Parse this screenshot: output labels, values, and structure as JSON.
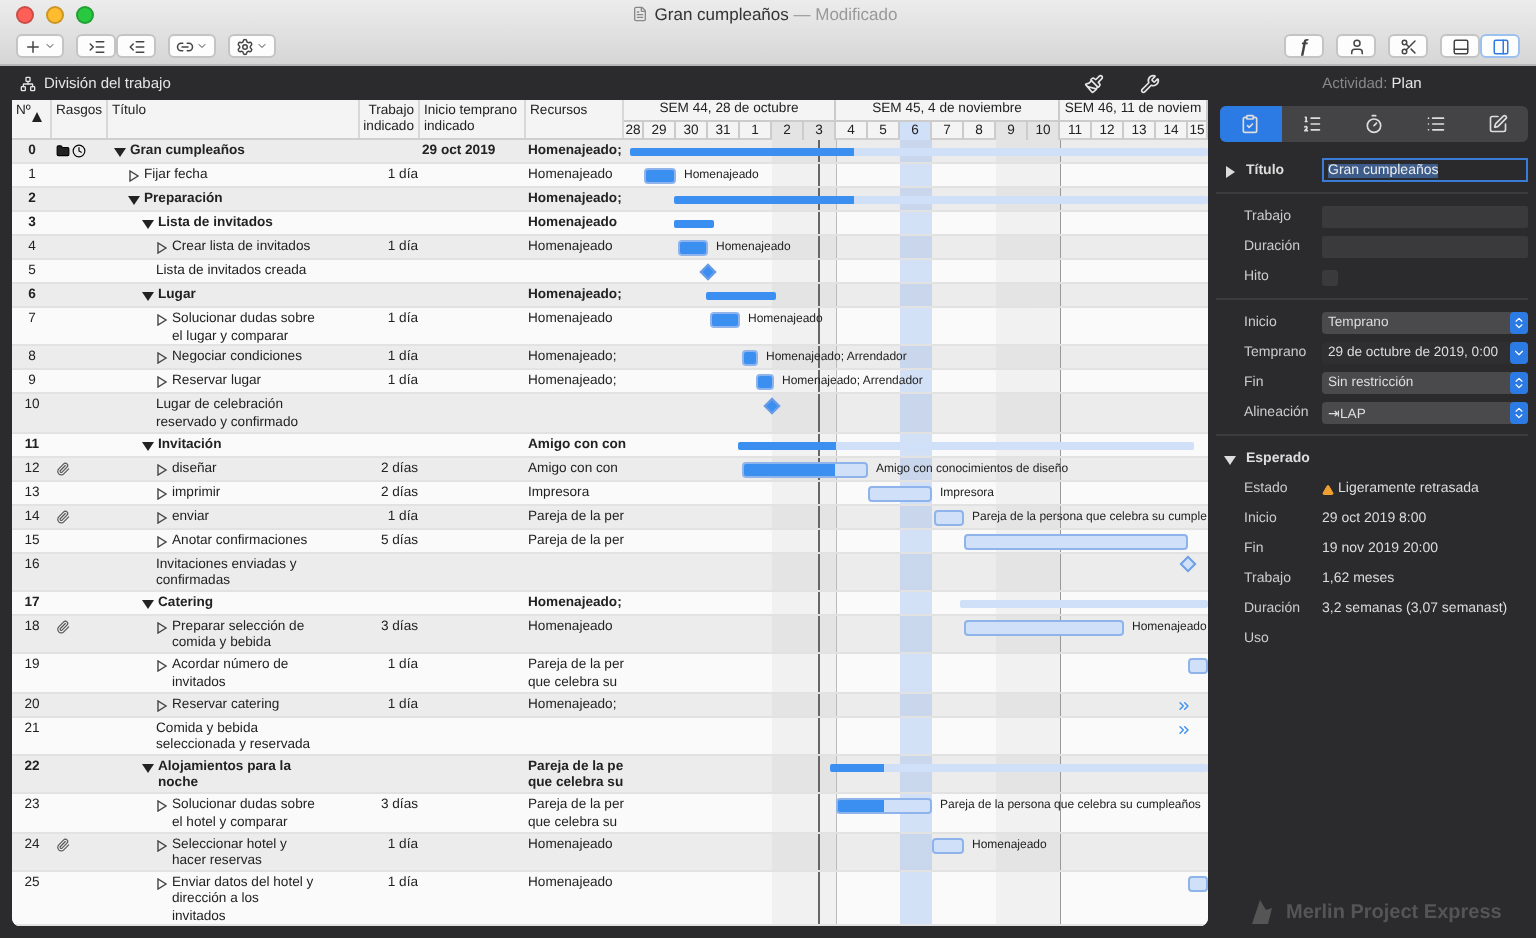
{
  "window": {
    "title": "Gran cumpleaños",
    "status": "— Modificado"
  },
  "toolbar": {
    "function_button": "ƒ",
    "view_toggles": [
      {
        "selected": false
      },
      {
        "selected": true
      }
    ]
  },
  "view_bar": {
    "view": "División del trabajo"
  },
  "table": {
    "columns": [
      {
        "label": "Nº",
        "sorted": true
      },
      {
        "label": "Rasgos"
      },
      {
        "label": "Título"
      },
      {
        "label": "Trabajo indicado"
      },
      {
        "label": "Inicio temprano indicado"
      },
      {
        "label": "Recursos"
      }
    ],
    "rows": [
      {
        "number": "0",
        "kind": "project",
        "expanded": true,
        "title": "Gran cumpleaños",
        "start": "29 oct 2019",
        "resources": "Homenajeado;",
        "children": [
          {
            "number": "1",
            "kind": "task",
            "title": "Fijar fecha",
            "work": "1 día",
            "resources": "Homenajeado",
            "bar_label": "Homenajeado"
          },
          {
            "number": "2",
            "kind": "group",
            "expanded": true,
            "title": "Preparación",
            "resources": "Homenajeado;",
            "children": [
              {
                "number": "3",
                "kind": "group",
                "expanded": true,
                "title": "Lista de invitados",
                "resources": "Homenajeado",
                "children": [
                  {
                    "number": "4",
                    "kind": "task",
                    "title": "Crear lista de invitados",
                    "work": "1 día",
                    "resources": "Homenajeado",
                    "bar_label": "Homenajeado"
                  },
                  {
                    "number": "5",
                    "kind": "milestone",
                    "title": "Lista de invitados creada"
                  }
                ]
              },
              {
                "number": "6",
                "kind": "group",
                "expanded": true,
                "title": "Lugar",
                "resources": "Homenajeado;",
                "children": [
                  {
                    "number": "7",
                    "kind": "task",
                    "title": "Solucionar dudas sobre el lugar y comparar",
                    "work": "1 día",
                    "resources": "Homenajeado",
                    "bar_label": "Homenajeado"
                  },
                  {
                    "number": "8",
                    "kind": "task",
                    "title": "Negociar condiciones",
                    "work": "1 día",
                    "resources": "Homenajeado;",
                    "bar_label": "Homenajeado; Arrendador"
                  },
                  {
                    "number": "9",
                    "kind": "task",
                    "title": "Reservar lugar",
                    "work": "1 día",
                    "resources": "Homenajeado;",
                    "bar_label": "Homenajeado; Arrendador"
                  },
                  {
                    "number": "10",
                    "kind": "milestone",
                    "title": "Lugar de celebración reservado y confirmado"
                  }
                ]
              },
              {
                "number": "11",
                "kind": "group",
                "expanded": true,
                "title": "Invitación",
                "resources": "Amigo con con",
                "children": [
                  {
                    "number": "12",
                    "kind": "task",
                    "attachment": true,
                    "title": "diseñar",
                    "work": "2 días",
                    "resources": "Amigo con con",
                    "bar_label": "Amigo con conocimientos de diseño"
                  },
                  {
                    "number": "13",
                    "kind": "task",
                    "title": "imprimir",
                    "work": "2 días",
                    "resources": "Impresora",
                    "bar_label": "Impresora"
                  },
                  {
                    "number": "14",
                    "kind": "task",
                    "attachment": true,
                    "title": "enviar",
                    "work": "1 día",
                    "resources": "Pareja de la per",
                    "bar_label": "Pareja de la persona que celebra su cumple"
                  },
                  {
                    "number": "15",
                    "kind": "task",
                    "title": "Anotar confirmaciones",
                    "work": "5 días",
                    "resources": "Pareja de la per"
                  },
                  {
                    "number": "16",
                    "kind": "milestone",
                    "title": "Invitaciones enviadas y confirmadas"
                  }
                ]
              },
              {
                "number": "17",
                "kind": "group",
                "expanded": true,
                "title": "Catering",
                "resources": "Homenajeado;",
                "children": [
                  {
                    "number": "18",
                    "kind": "task",
                    "attachment": true,
                    "title": "Preparar selección de comida y bebida",
                    "work": "3 días",
                    "resources": "Homenajeado",
                    "bar_label": "Homenajeado"
                  },
                  {
                    "number": "19",
                    "kind": "task",
                    "title": "Acordar número de invitados",
                    "work": "1 día",
                    "resources": "Pareja de la per\nque celebra su"
                  },
                  {
                    "number": "20",
                    "kind": "task",
                    "title": "Reservar catering",
                    "work": "1 día",
                    "resources": "Homenajeado;"
                  },
                  {
                    "number": "21",
                    "kind": "milestone",
                    "title": "Comida y bebida seleccionada y reservada"
                  }
                ]
              },
              {
                "number": "22",
                "kind": "group",
                "expanded": true,
                "title": "Alojamientos para la noche",
                "resources": "Pareja de la pe\nque celebra su",
                "children": [
                  {
                    "number": "23",
                    "kind": "task",
                    "title": "Solucionar dudas sobre el hotel y comparar",
                    "work": "3 días",
                    "resources": "Pareja de la per\nque celebra su",
                    "bar_label": "Pareja de la persona que celebra su cumpleaños"
                  },
                  {
                    "number": "24",
                    "kind": "task",
                    "attachment": true,
                    "title": "Seleccionar hotel y hacer reservas",
                    "work": "1 día",
                    "resources": "Homenajeado",
                    "bar_label": "Homenajeado"
                  },
                  {
                    "number": "25",
                    "kind": "task",
                    "title": "Enviar datos del hotel y dirección a los invitados",
                    "work": "1 día",
                    "resources": "Homenajeado"
                  }
                ]
              }
            ]
          }
        ]
      }
    ]
  },
  "timeline": {
    "weeks": [
      {
        "label": "SEM 44, 28 de octubre",
        "days": [
          {
            "label": "28",
            "weekend": false,
            "today": false
          },
          {
            "label": "29",
            "weekend": false,
            "today": false
          },
          {
            "label": "30",
            "weekend": false,
            "today": false
          },
          {
            "label": "31",
            "weekend": false,
            "today": false
          },
          {
            "label": "1",
            "weekend": false,
            "today": false
          },
          {
            "label": "2",
            "weekend": true,
            "today": false
          },
          {
            "label": "3",
            "weekend": true,
            "today": false
          }
        ]
      },
      {
        "label": "SEM 45, 4 de noviembre",
        "days": [
          {
            "label": "4",
            "weekend": false,
            "today": false
          },
          {
            "label": "5",
            "weekend": false,
            "today": false
          },
          {
            "label": "6",
            "weekend": false,
            "today": true
          },
          {
            "label": "7",
            "weekend": false,
            "today": false
          },
          {
            "label": "8",
            "weekend": false,
            "today": false
          },
          {
            "label": "9",
            "weekend": true,
            "today": false
          },
          {
            "label": "10",
            "weekend": true,
            "today": false
          }
        ]
      },
      {
        "label": "SEM 46, 11 de noviem",
        "days": [
          {
            "label": "11",
            "weekend": false,
            "today": false
          },
          {
            "label": "12",
            "weekend": false,
            "today": false
          },
          {
            "label": "13",
            "weekend": false,
            "today": false
          },
          {
            "label": "14",
            "weekend": false,
            "today": false
          },
          {
            "label": "15",
            "weekend": false,
            "today": false
          }
        ]
      }
    ]
  },
  "inspector": {
    "activity_label": "Actividad:",
    "activity": "Plan",
    "tabs": [
      {
        "selected": true
      },
      {
        "selected": false
      },
      {
        "selected": false
      },
      {
        "selected": false
      },
      {
        "selected": false
      }
    ],
    "title": {
      "label": "Título",
      "expanded": false,
      "value": "Gran cumpleaños"
    },
    "field_groups": [
      [
        {
          "kind": "text",
          "label": "Trabajo"
        },
        {
          "kind": "text",
          "label": "Duración"
        },
        {
          "kind": "checkbox",
          "label": "Hito",
          "checked": false
        }
      ],
      [
        {
          "kind": "select",
          "label": "Inicio",
          "value": "Temprano"
        },
        {
          "kind": "date",
          "label": "Temprano",
          "value": "29 de octubre de 2019, 0:00"
        },
        {
          "kind": "select",
          "label": "Fin",
          "value": "Sin restricción"
        },
        {
          "kind": "select",
          "label": "Alineación",
          "value": "⇥LAP"
        }
      ]
    ],
    "expected": {
      "label": "Esperado",
      "expanded": true,
      "rows": [
        {
          "kind": "warning",
          "label": "Estado",
          "value": "Ligeramente retrasada"
        },
        {
          "kind": "plain",
          "label": "Inicio",
          "value": "29 oct 2019 8:00"
        },
        {
          "kind": "plain",
          "label": "Fin",
          "value": "19 nov 2019 20:00"
        },
        {
          "kind": "plain",
          "label": "Trabajo",
          "value": "1,62 meses"
        },
        {
          "kind": "plain",
          "label": "Duración",
          "value": "3,2 semanas (3,07 semanast)"
        },
        {
          "kind": "plain",
          "label": "Uso"
        }
      ]
    }
  },
  "brand": "Merlin Project Express"
}
